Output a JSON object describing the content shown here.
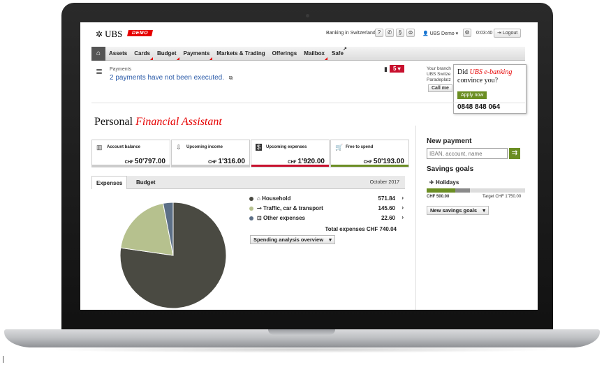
{
  "header": {
    "logo_text": "UBS",
    "demo_badge": "DEMO",
    "country": "Banking in Switzerland",
    "user": "UBS Demo",
    "timer": "0:03:40",
    "logout_label": "Logout"
  },
  "nav": {
    "items": [
      "Assets",
      "Cards",
      "Budget",
      "Payments",
      "Markets & Trading",
      "Offerings",
      "Mailbox",
      "Safe"
    ]
  },
  "notification": {
    "title": "Payments",
    "message": "2 payments have not been executed.",
    "count": "5"
  },
  "branch": {
    "line1": "Your branch",
    "line2": "UBS Switze",
    "line3": "Paradeplatz",
    "callme_label": "Call me"
  },
  "promo": {
    "question_start": "Did ",
    "question_brand": "UBS e-banking",
    "question_end": "convince you?",
    "apply_label": "Apply now",
    "phone": "0848 848 064"
  },
  "pfa": {
    "title_plain": "Personal",
    "title_accent": "Financial Assistant",
    "cards": [
      {
        "label": "Account balance",
        "currency": "CHF",
        "amount": "50'797.00",
        "bar_color": "#cccccc"
      },
      {
        "label": "Upcoming income",
        "currency": "CHF",
        "amount": "1'316.00",
        "bar_color": "#cccccc"
      },
      {
        "label": "Upcoming expenses",
        "currency": "CHF",
        "amount": "1'920.00",
        "bar_color": "#c8102e"
      },
      {
        "label": "Free to spend",
        "currency": "CHF",
        "amount": "50'193.00",
        "bar_color": "#6b8e23"
      }
    ]
  },
  "tabs": {
    "expenses": "Expenses",
    "budget": "Budget",
    "month": "October 2017"
  },
  "chart_data": {
    "type": "pie",
    "categories": [
      "Household",
      "Traffic, car & transport",
      "Other expenses"
    ],
    "values": [
      571.84,
      145.6,
      22.6
    ],
    "colors": [
      "#4a4a42",
      "#b6c18e",
      "#5c6f86"
    ],
    "total_label": "Total expenses CHF 740.04"
  },
  "spending_btn": "Spending analysis overview",
  "new_payment": {
    "title": "New payment",
    "placeholder": "IBAN, account, name"
  },
  "savings": {
    "title": "Savings goals",
    "goal_name": "Holidays",
    "current": "CHF 500.00",
    "target": "Target CHF 1'750.00",
    "progress": 0.29,
    "button": "New savings goals"
  }
}
